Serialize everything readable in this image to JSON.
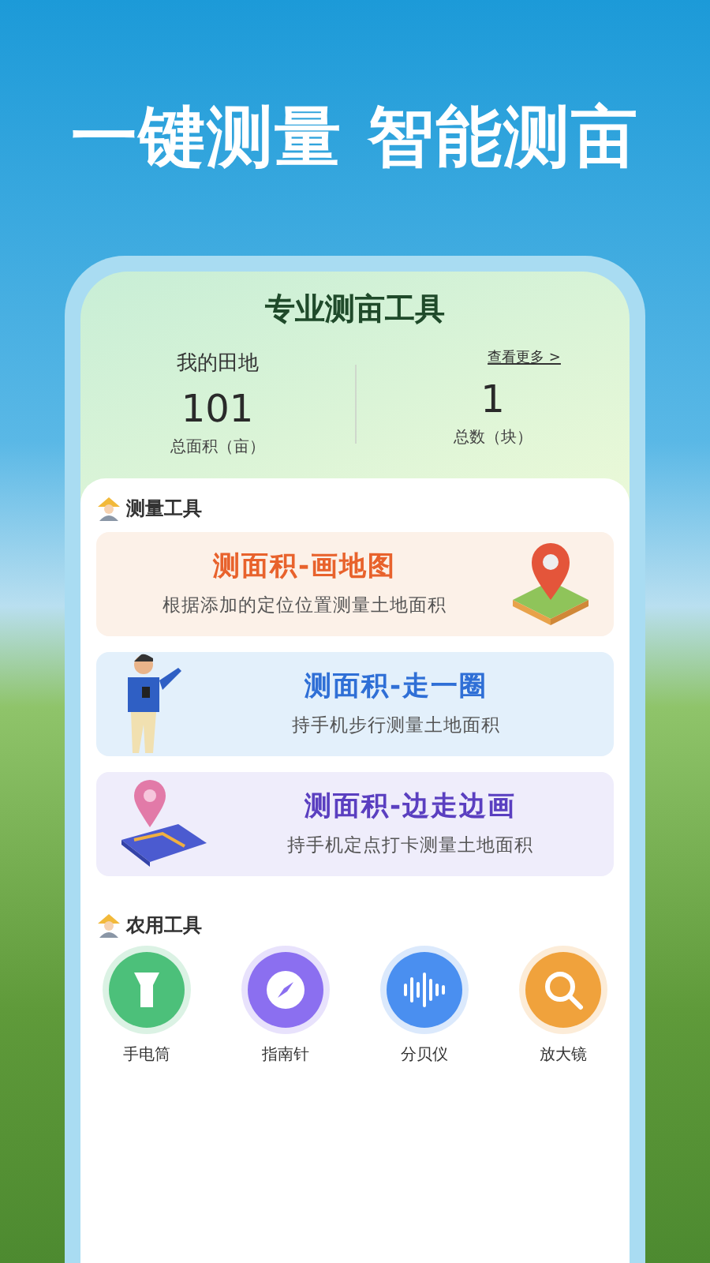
{
  "headline": "一键测量 智能测亩",
  "screen": {
    "title": "专业测亩工具",
    "my_fields": {
      "label": "我的田地",
      "more_link": "查看更多 >",
      "stats": [
        {
          "value": "101",
          "label": "总面积（亩）"
        },
        {
          "value": "1",
          "label": "总数（块）"
        }
      ]
    },
    "measure_section": {
      "title": "测量工具",
      "cards": [
        {
          "kind": "map",
          "title": "测面积-画地图",
          "subtitle": "根据添加的定位位置测量土地面积",
          "color": "#e8622c"
        },
        {
          "kind": "walk",
          "title": "测面积-走一圈",
          "subtitle": "持手机步行测量土地面积",
          "color": "#2f6fd6"
        },
        {
          "kind": "point",
          "title": "测面积-边走边画",
          "subtitle": "持手机定点打卡测量土地面积",
          "color": "#5a3fc0"
        }
      ]
    },
    "farm_section": {
      "title": "农用工具",
      "tools": [
        {
          "kind": "flashlight",
          "label": "手电筒",
          "color": "#4cc07a"
        },
        {
          "kind": "compass",
          "label": "指南针",
          "color": "#8b6ff0"
        },
        {
          "kind": "decibel",
          "label": "分贝仪",
          "color": "#4a8ff0"
        },
        {
          "kind": "magnifier",
          "label": "放大镜",
          "color": "#f0a23c"
        }
      ]
    }
  }
}
